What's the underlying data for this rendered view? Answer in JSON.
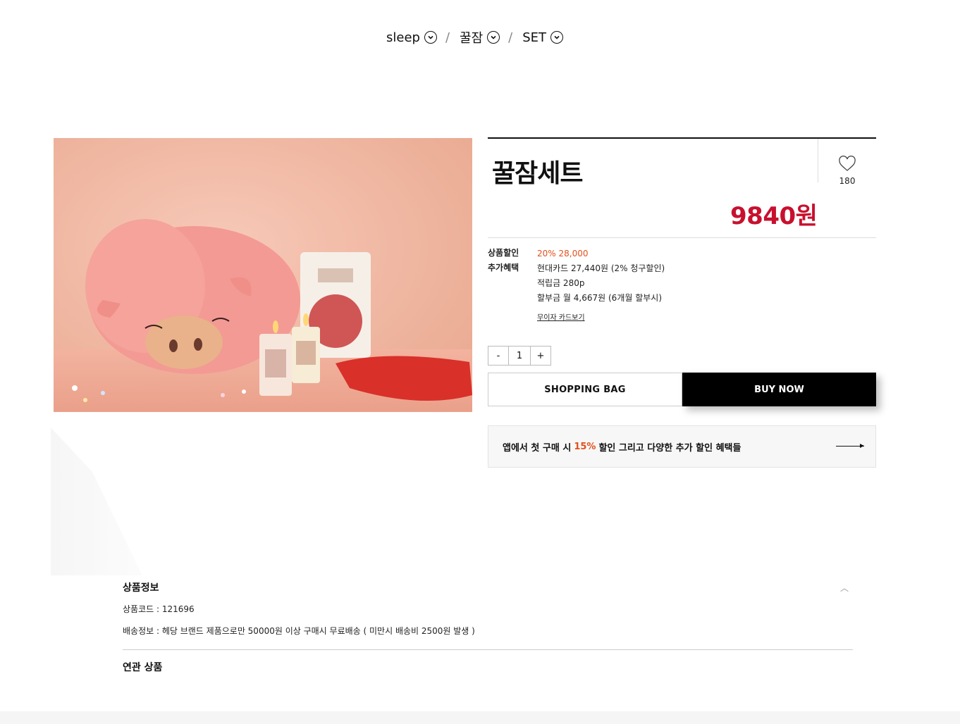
{
  "breadcrumb": [
    {
      "label": "sleep",
      "icon": "chevron-down-circle-icon"
    },
    {
      "label": "꿀잠",
      "icon": "chevron-down-circle-icon"
    },
    {
      "label": "SET",
      "icon": "chevron-down-circle-icon"
    }
  ],
  "breadcrumb_separator": "/",
  "product": {
    "title": "꿀잠세트",
    "price": "9840원",
    "likes": "180",
    "like_icon": "heart-outline-icon"
  },
  "benefits": {
    "discount_label": "상품할인",
    "discount_value": "20% 28,000",
    "extra_label": "추가혜택",
    "extra_lines": [
      "현대카드 27,440원 (2% 청구할인)",
      "적립금 280p",
      "할부금 월 4,667원 (6개월 할부시)"
    ],
    "card_link": "무이자 카드보기"
  },
  "quantity": {
    "minus": "-",
    "value": "1",
    "plus": "+"
  },
  "buttons": {
    "bag": "SHOPPING BAG",
    "buy": "BUY NOW"
  },
  "promo": {
    "before": "앱에서 첫 구매 시",
    "percent": "15%",
    "after": "할인 그리고 다양한 추가 할인 혜택들"
  },
  "details": {
    "title": "상품정보",
    "code": "상품코드 : 121696",
    "shipping": "배송정보 : 헤당 브랜드 제품으로만 50000원 이상 구매시 무료배송 ( 미만시 배송비 2500원 발생 )",
    "related": "연관 상품"
  },
  "colors": {
    "accent_price": "#c8102e",
    "accent_discount": "#e2501b",
    "buy_bg": "#000000"
  }
}
